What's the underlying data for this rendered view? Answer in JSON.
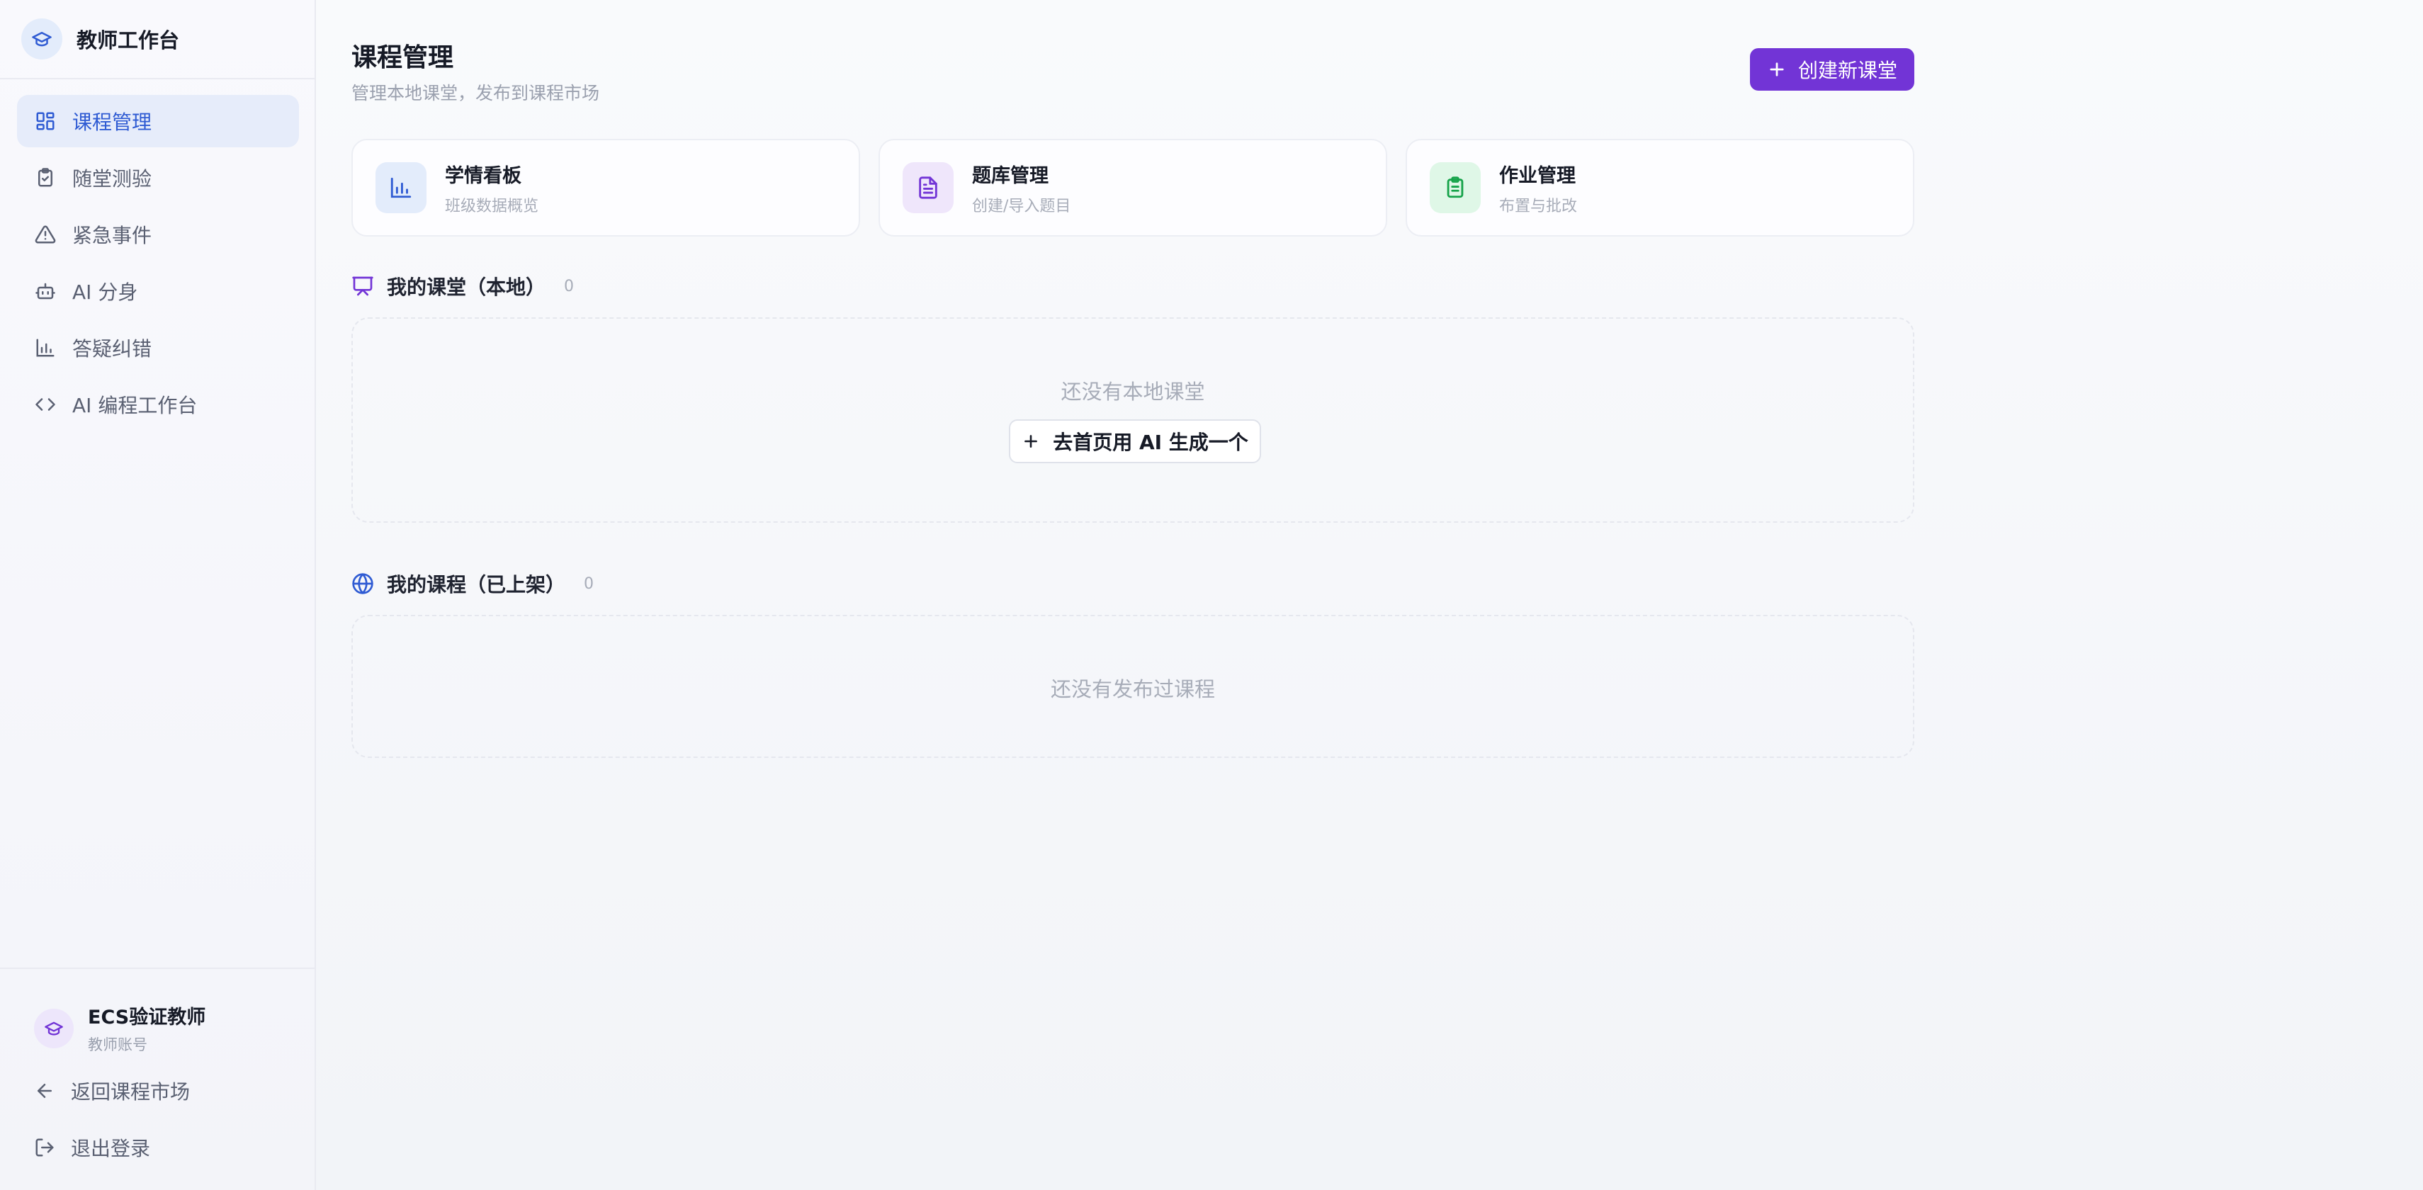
{
  "sidebar": {
    "brand": {
      "title": "教师工作台",
      "icon": "graduation-cap-icon"
    },
    "items": [
      {
        "label": "课程管理",
        "icon": "layout-grid-icon",
        "active": true
      },
      {
        "label": "随堂测验",
        "icon": "clipboard-check-icon"
      },
      {
        "label": "紧急事件",
        "icon": "alert-triangle-icon"
      },
      {
        "label": "AI 分身",
        "icon": "bot-icon"
      },
      {
        "label": "答疑纠错",
        "icon": "bar-chart-icon"
      },
      {
        "label": "AI 编程工作台",
        "icon": "code-icon"
      }
    ],
    "user": {
      "name": "ECS验证教师",
      "role": "教师账号",
      "icon": "graduation-cap-icon"
    },
    "back_label": "返回课程市场",
    "logout_label": "退出登录"
  },
  "header": {
    "title": "课程管理",
    "subtitle": "管理本地课堂，发布到课程市场",
    "create_label": "创建新课堂"
  },
  "cards": [
    {
      "title": "学情看板",
      "subtitle": "班级数据概览",
      "icon": "bar-chart-icon",
      "color": "#2f5bd3",
      "bg": "#e3ecfb"
    },
    {
      "title": "题库管理",
      "subtitle": "创建/导入题目",
      "icon": "file-text-icon",
      "color": "#7234d6",
      "bg": "#efe6fb"
    },
    {
      "title": "作业管理",
      "subtitle": "布置与批改",
      "icon": "clipboard-list-icon",
      "color": "#16a34a",
      "bg": "#dff7e7"
    }
  ],
  "sections": {
    "local": {
      "title": "我的课堂（本地）",
      "count": "0",
      "empty_text": "还没有本地课堂",
      "action_label": "去首页用 AI 生成一个",
      "icon": "presentation-icon"
    },
    "published": {
      "title": "我的课程（已上架）",
      "count": "0",
      "empty_text": "还没有发布过课程",
      "icon": "globe-icon"
    }
  },
  "colors": {
    "accent": "#7234d6",
    "active_nav": "#2f5bd3"
  }
}
